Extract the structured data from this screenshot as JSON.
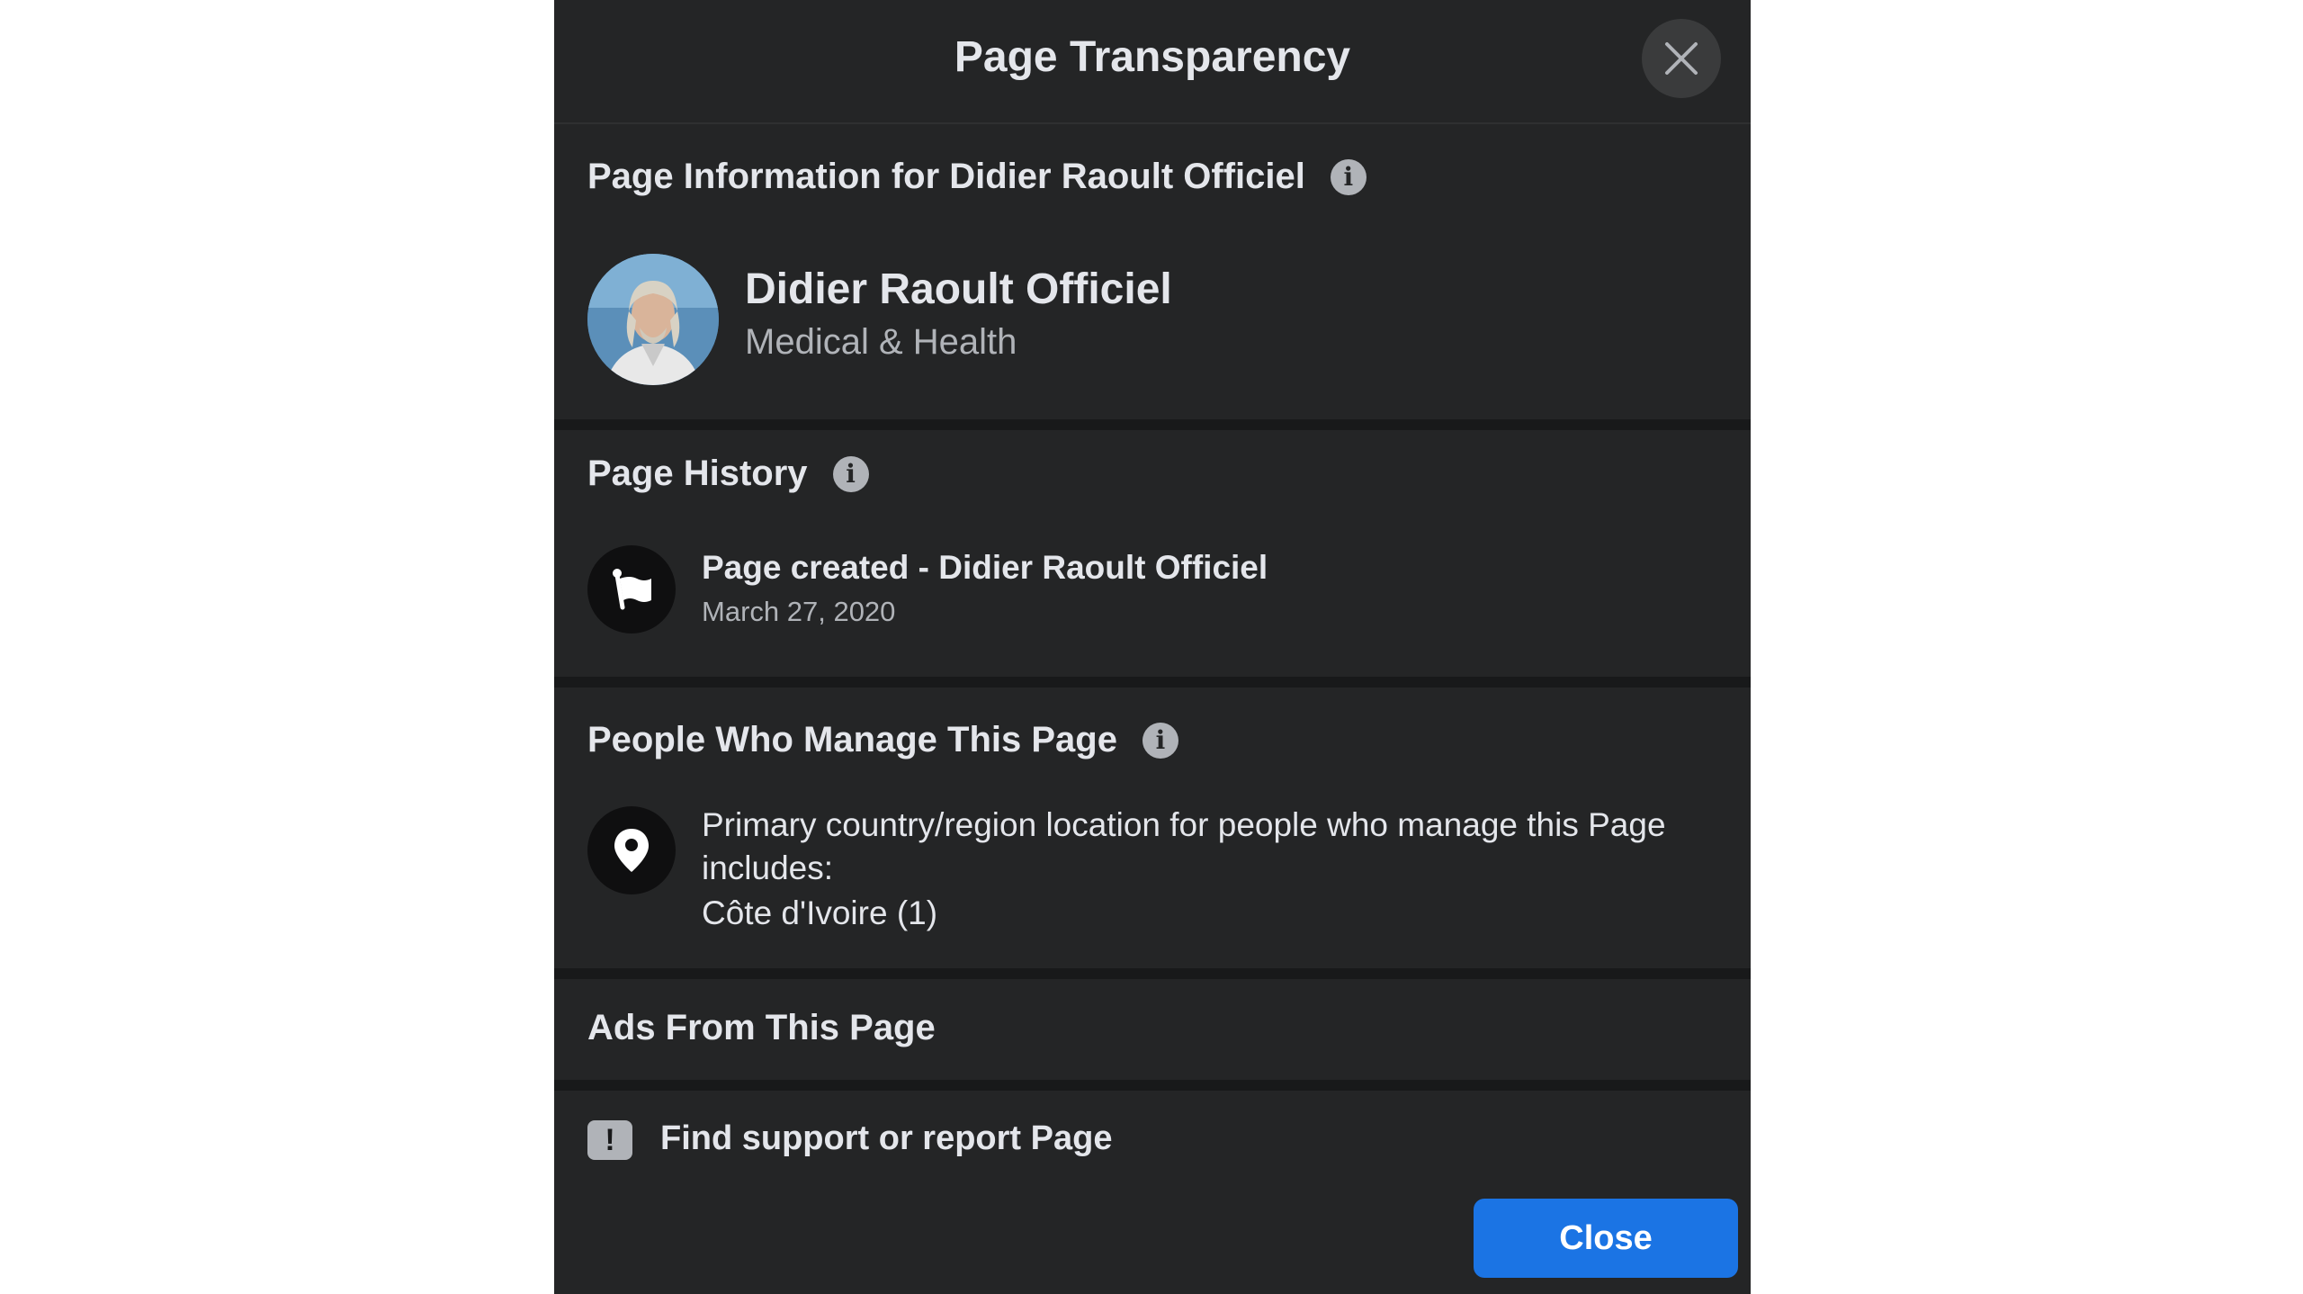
{
  "dialog": {
    "title": "Page Transparency",
    "close_icon": "close-icon"
  },
  "page_info": {
    "title": "Page Information for Didier Raoult Officiel",
    "info_icon_glyph": "i",
    "page_name": "Didier Raoult Officiel",
    "category": "Medical & Health"
  },
  "page_history": {
    "title": "Page History",
    "info_icon_glyph": "i",
    "event": "Page created - Didier Raoult Officiel",
    "date": "March 27, 2020",
    "icon": "flag-icon"
  },
  "people_manage": {
    "title": "People Who Manage This Page",
    "info_icon_glyph": "i",
    "line1": "Primary country/region location for people who manage this Page",
    "line2": "includes:",
    "location": "Côte d'Ivoire (1)",
    "icon": "location-pin-icon"
  },
  "ads": {
    "title": "Ads From This Page"
  },
  "footer": {
    "report_icon_glyph": "!",
    "report_label": "Find support or report Page",
    "close_label": "Close"
  },
  "colors": {
    "background": "#18191a",
    "card": "#242526",
    "primary_text": "#e4e6eb",
    "secondary_text": "#b0b3b8",
    "accent": "#1b74e4"
  }
}
